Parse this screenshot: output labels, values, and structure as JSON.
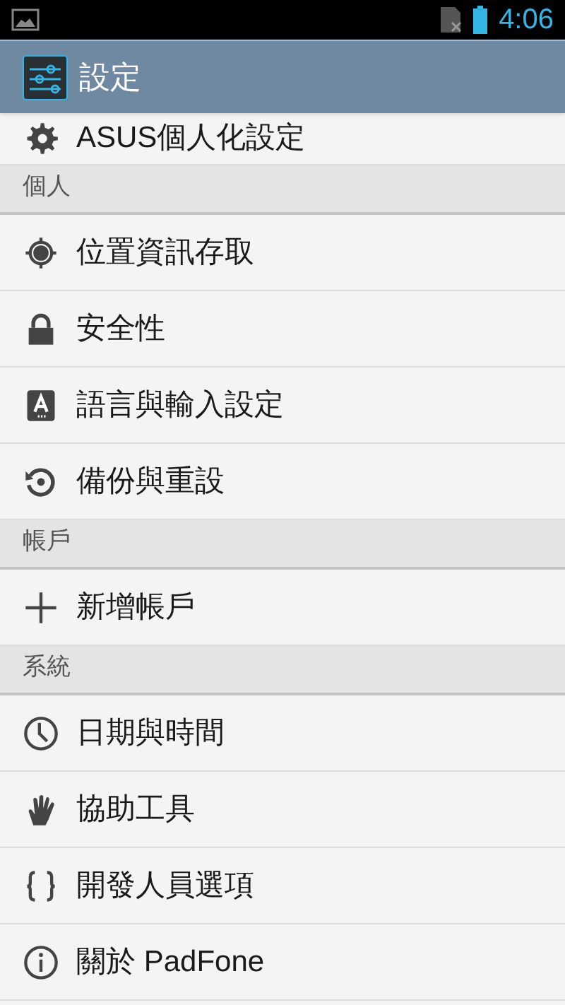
{
  "status_bar": {
    "time": "4:06"
  },
  "action_bar": {
    "title": "設定"
  },
  "items": [
    {
      "kind": "row",
      "label": "ASUS個人化設定"
    },
    {
      "kind": "header",
      "label": "個人"
    },
    {
      "kind": "row",
      "label": "位置資訊存取"
    },
    {
      "kind": "row",
      "label": "安全性"
    },
    {
      "kind": "row",
      "label": "語言與輸入設定"
    },
    {
      "kind": "row",
      "label": "備份與重設"
    },
    {
      "kind": "header",
      "label": "帳戶"
    },
    {
      "kind": "row",
      "label": "新增帳戶"
    },
    {
      "kind": "header",
      "label": "系統"
    },
    {
      "kind": "row",
      "label": "日期與時間"
    },
    {
      "kind": "row",
      "label": "協助工具"
    },
    {
      "kind": "row",
      "label": "開發人員選項"
    },
    {
      "kind": "row",
      "label": "關於 PadFone"
    }
  ]
}
